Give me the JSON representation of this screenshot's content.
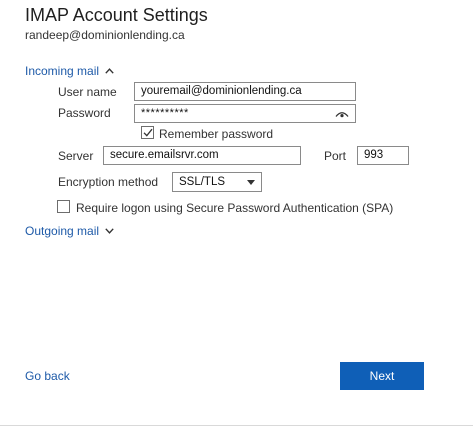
{
  "dialog": {
    "title": "IMAP Account Settings",
    "account_email": "randeep@dominionlending.ca"
  },
  "incoming": {
    "section_label": "Incoming mail",
    "expanded": true,
    "username_label": "User name",
    "username_value": "youremail@dominionlending.ca",
    "password_label": "Password",
    "password_value": "**********",
    "remember_label": "Remember password",
    "remember_checked": true,
    "server_label": "Server",
    "server_value": "secure.emailsrvr.com",
    "port_label": "Port",
    "port_value": "993",
    "encryption_label": "Encryption method",
    "encryption_value": "SSL/TLS",
    "spa_label": "Require logon using Secure Password Authentication (SPA)",
    "spa_checked": false
  },
  "outgoing": {
    "section_label": "Outgoing mail",
    "expanded": false
  },
  "footer": {
    "back_label": "Go back",
    "next_label": "Next"
  },
  "colors": {
    "accent": "#0f5fb7",
    "link": "#1e5aa8"
  },
  "icons": [
    "chevron-up-icon",
    "eye-icon",
    "checkmark-icon",
    "dropdown-caret-icon",
    "chevron-down-icon"
  ]
}
